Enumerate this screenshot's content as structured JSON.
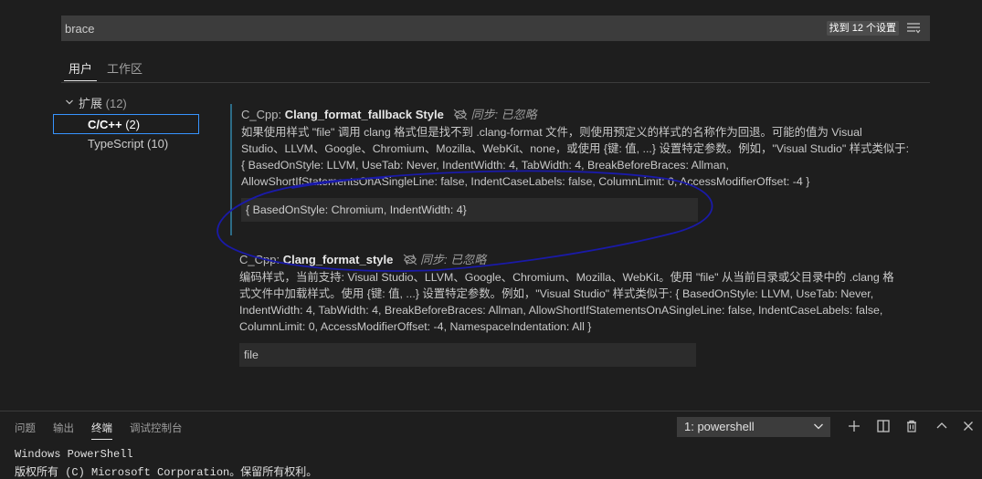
{
  "search": {
    "value": "brace",
    "result_count": "找到 12 个设置",
    "filter_icon": "list-filter-icon"
  },
  "tabs": [
    {
      "label": "用户",
      "active": true
    },
    {
      "label": "工作区",
      "active": false
    }
  ],
  "toc": {
    "group_label": "扩展",
    "group_count": "(12)",
    "items": [
      {
        "label": "C/C++",
        "count": "(2)",
        "selected": true
      },
      {
        "label": "TypeScript",
        "count": "(10)",
        "selected": false
      }
    ]
  },
  "settings": [
    {
      "category": "C_Cpp: ",
      "name": "Clang_format_fallback Style",
      "sync_status": "同步: 已忽略",
      "description": "如果使用样式 \"file\" 调用 clang 格式但是找不到 .clang-format 文件，则使用预定义的样式的名称作为回退。可能的值为 Visual\nStudio、LLVM、Google、Chromium、Mozilla、WebKit、none，或使用 {键: 值, ...} 设置特定参数。例如，\"Visual Studio\" 样式类似于:\n{ BasedOnStyle: LLVM, UseTab: Never, IndentWidth: 4, TabWidth: 4, BreakBeforeBraces: Allman,\nAllowShortIfStatementsOnASingleLine: false, IndentCaseLabels: false, ColumnLimit: 0, AccessModifierOffset: -4 }",
      "value": "{ BasedOnStyle: Chromium, IndentWidth: 4}"
    },
    {
      "category": "C_Cpp: ",
      "name": "Clang_format_style",
      "sync_status": "同步: 已忽略",
      "description": "编码样式，当前支持: Visual Studio、LLVM、Google、Chromium、Mozilla、WebKit。使用 \"file\" 从当前目录或父目录中的 .clang 格\n式文件中加载样式。使用 {键: 值, ...} 设置特定参数。例如，\"Visual Studio\" 样式类似于: { BasedOnStyle: LLVM, UseTab: Never,\nIndentWidth: 4, TabWidth: 4, BreakBeforeBraces: Allman, AllowShortIfStatementsOnASingleLine: false, IndentCaseLabels: false,\nColumnLimit: 0, AccessModifierOffset: -4, NamespaceIndentation: All }",
      "value": "file"
    }
  ],
  "panel": {
    "tabs": [
      {
        "label": "问题",
        "active": false
      },
      {
        "label": "输出",
        "active": false
      },
      {
        "label": "终端",
        "active": true
      },
      {
        "label": "调试控制台",
        "active": false
      }
    ],
    "terminal_select": "1: powershell",
    "actions": [
      "plus-icon",
      "split-terminal-icon",
      "trash-icon",
      "chevron-up-icon",
      "close-icon"
    ],
    "terminal_lines": [
      "Windows PowerShell",
      "版权所有 (C) Microsoft Corporation。保留所有权利。"
    ]
  },
  "colors": {
    "background": "#1e1e1e",
    "input_background": "#3c3c3c",
    "focus_border": "#3794ff",
    "modified_bar": "#2d6c86",
    "annotation_ink": "#1a1aa8"
  }
}
